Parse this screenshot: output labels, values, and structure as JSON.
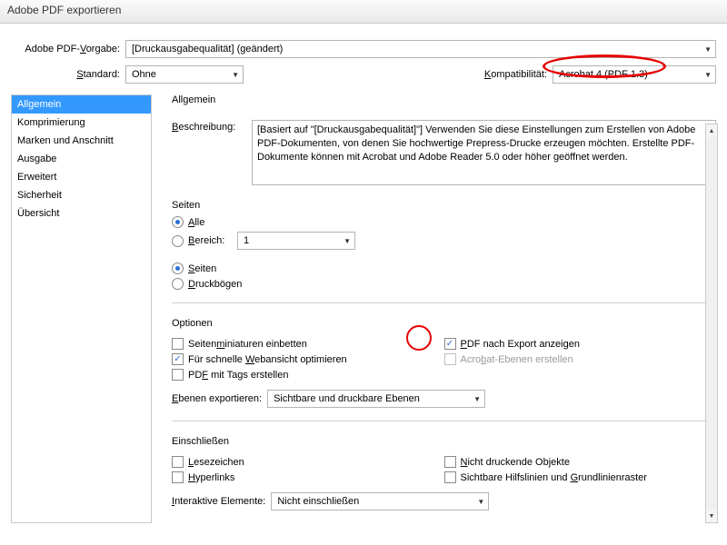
{
  "window": {
    "title": "Adobe PDF exportieren"
  },
  "preset": {
    "label_pre": "Adobe PDF-",
    "label_u": "V",
    "label_post": "orgabe:",
    "value": "[Druckausgabequalität] (geändert)"
  },
  "standard": {
    "label_u": "S",
    "label_post": "tandard:",
    "value": "Ohne"
  },
  "compat": {
    "label_u": "K",
    "label_post": "ompatibilität:",
    "value": "Acrobat 4 (PDF 1.3)"
  },
  "sidebar": {
    "items": [
      {
        "label": "Allgemein"
      },
      {
        "label": "Komprimierung"
      },
      {
        "label": "Marken und Anschnitt"
      },
      {
        "label": "Ausgabe"
      },
      {
        "label": "Erweitert"
      },
      {
        "label": "Sicherheit"
      },
      {
        "label": "Übersicht"
      }
    ]
  },
  "main": {
    "heading": "Allgemein",
    "description_label_u": "B",
    "description_label_post": "eschreibung:",
    "description": "[Basiert auf \"[Druckausgabequalität]\"] Verwenden Sie diese Einstellungen zum Erstellen von Adobe PDF-Dokumenten, von denen Sie hochwertige Prepress-Drucke erzeugen möchten. Erstellte PDF-Dokumente können mit Acrobat und Adobe Reader 5.0 oder höher geöffnet werden.",
    "pages": {
      "title": "Seiten",
      "all": "Alle",
      "all_u": "A",
      "range": "Bereich:",
      "range_u": "B",
      "range_value": "1",
      "pages_radio": "Seiten",
      "pages_u": "S",
      "spreads": "Druckbögen",
      "spreads_u": "D"
    },
    "options": {
      "title": "Optionen",
      "thumb_pre": "Seiten",
      "thumb_u": "m",
      "thumb_post": "iniaturen einbetten",
      "showpdf": "DF nach Export anzeigen",
      "showpdf_u": "P",
      "fastweb": "Für schnelle ",
      "fastweb_u": "W",
      "fastweb_post": "ebansicht optimieren",
      "layers": "Acro",
      "layers_u": "b",
      "layers_post": "at-Ebenen erstellen",
      "tags": "PD",
      "tags_u": "F",
      "tags_post": " mit Tags erstellen",
      "export_layers_label": "Ebenen exportieren:",
      "export_layers_u": "E",
      "export_layers_value": "Sichtbare und druckbare Ebenen"
    },
    "include": {
      "title": "Einschließen",
      "bookmarks": "esezeichen",
      "bookmarks_u": "L",
      "nonprint": "icht druckende Objekte",
      "nonprint_u": "N",
      "hyperlinks": "yperlinks",
      "hyperlinks_u": "H",
      "guides": "Sichtbare Hilfslinien und ",
      "guides_u": "G",
      "guides_post": "rundlinienraster",
      "interactive_label_u": "I",
      "interactive_label_post": "nteraktive Elemente:",
      "interactive_value": "Nicht einschließen"
    }
  }
}
